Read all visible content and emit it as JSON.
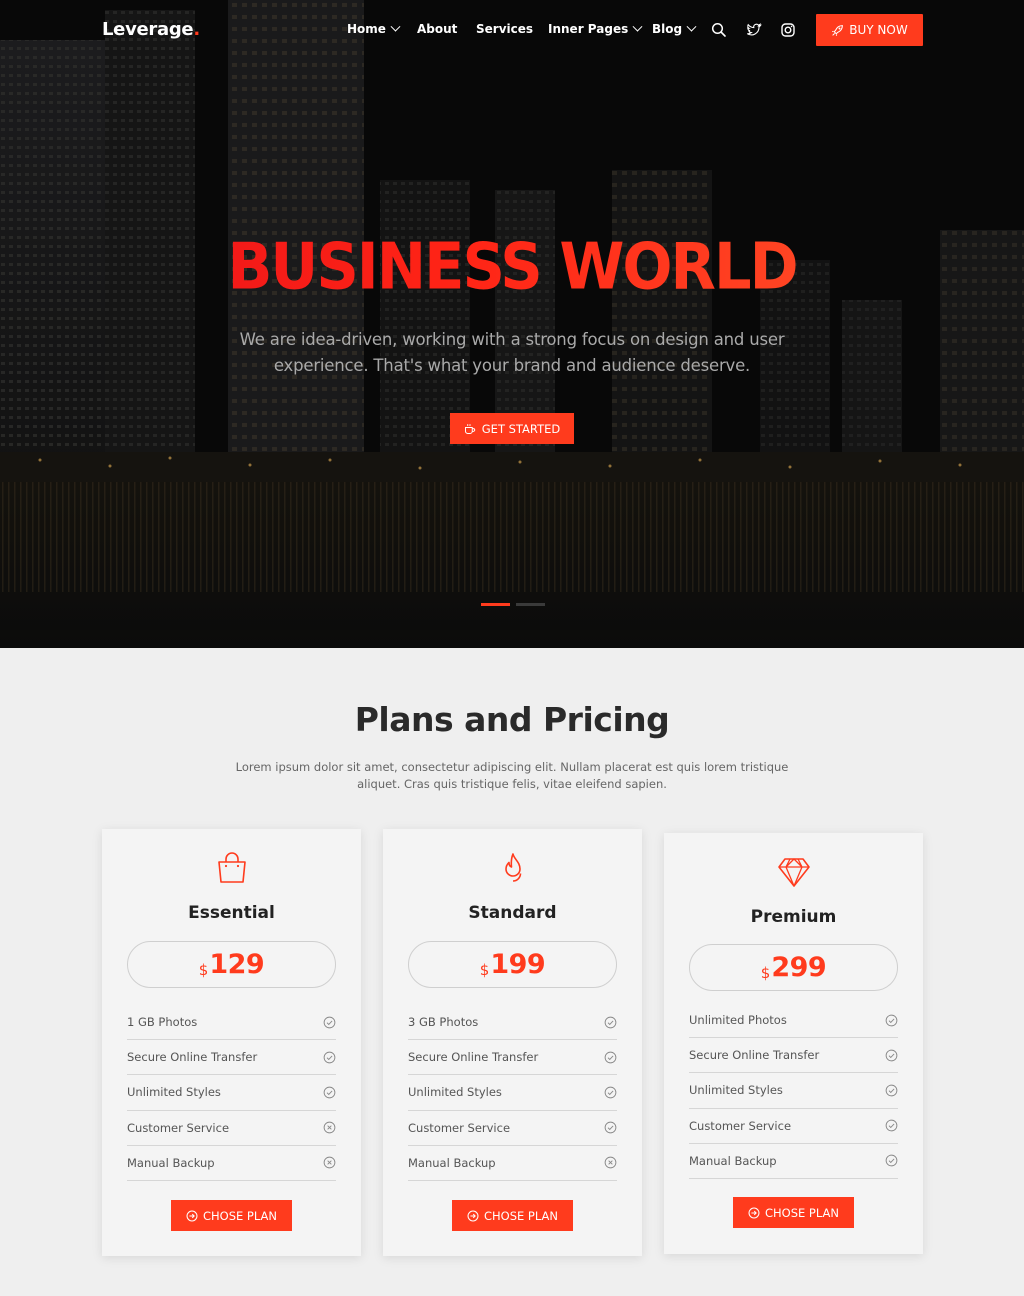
{
  "brand": {
    "name": "Leverage",
    "dot": ".",
    "accent": "#ff3b1d"
  },
  "nav": {
    "items": [
      {
        "label": "Home",
        "dropdown": true
      },
      {
        "label": "About",
        "dropdown": false
      },
      {
        "label": "Services",
        "dropdown": false
      },
      {
        "label": "Inner Pages",
        "dropdown": true
      },
      {
        "label": "Blog",
        "dropdown": true
      }
    ],
    "icons": [
      "search-icon",
      "twitter-icon",
      "instagram-icon"
    ],
    "buy_label": "BUY NOW"
  },
  "hero": {
    "title": "BUSINESS WORLD",
    "subtitle": "We are idea-driven, working with a strong focus on design and user experience. That's what your brand and audience deserve.",
    "cta_label": "GET STARTED",
    "slides": 2,
    "active_slide": 1
  },
  "pricing": {
    "title": "Plans and Pricing",
    "description": "Lorem ipsum dolor sit amet, consectetur adipiscing elit. Nullam placerat est quis lorem tristique aliquet. Cras quis tristique felis, vitae eleifend sapien.",
    "plans": [
      {
        "name": "Essential",
        "icon": "shopping-bag-icon",
        "currency": "$",
        "price": "129",
        "features": [
          {
            "label": "1 GB Photos",
            "included": true
          },
          {
            "label": "Secure Online Transfer",
            "included": true
          },
          {
            "label": "Unlimited Styles",
            "included": true
          },
          {
            "label": "Customer Service",
            "included": false
          },
          {
            "label": "Manual Backup",
            "included": false
          }
        ],
        "button_label": "CHOSE PLAN"
      },
      {
        "name": "Standard",
        "icon": "fire-icon",
        "currency": "$",
        "price": "199",
        "features": [
          {
            "label": "3 GB Photos",
            "included": true
          },
          {
            "label": "Secure Online Transfer",
            "included": true
          },
          {
            "label": "Unlimited Styles",
            "included": true
          },
          {
            "label": "Customer Service",
            "included": true
          },
          {
            "label": "Manual Backup",
            "included": false
          }
        ],
        "button_label": "CHOSE PLAN"
      },
      {
        "name": "Premium",
        "icon": "diamond-icon",
        "currency": "$",
        "price": "299",
        "features": [
          {
            "label": "Unlimited Photos",
            "included": true
          },
          {
            "label": "Secure Online Transfer",
            "included": true
          },
          {
            "label": "Unlimited Styles",
            "included": true
          },
          {
            "label": "Customer Service",
            "included": true
          },
          {
            "label": "Manual Backup",
            "included": true
          }
        ],
        "button_label": "CHOSE PLAN"
      }
    ]
  }
}
